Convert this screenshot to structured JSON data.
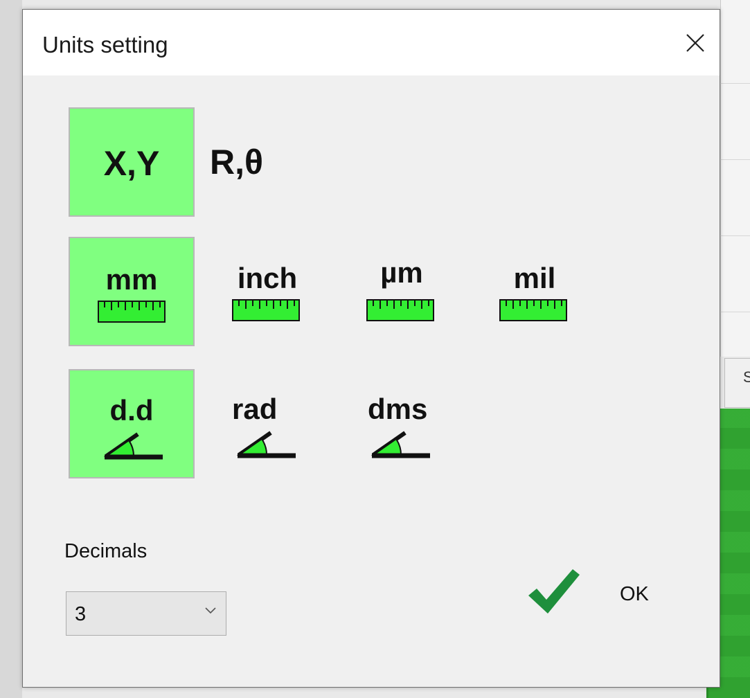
{
  "dialog": {
    "title": "Units setting",
    "close_icon": "close-icon"
  },
  "coordinates": [
    {
      "label": "X,Y",
      "selected": true
    },
    {
      "label": "R,θ",
      "selected": false
    }
  ],
  "length_units": [
    {
      "label": "mm",
      "icon": "ruler-icon",
      "selected": true
    },
    {
      "label": "inch",
      "icon": "ruler-icon",
      "selected": false
    },
    {
      "label": "µm",
      "icon": "ruler-icon",
      "selected": false
    },
    {
      "label": "mil",
      "icon": "ruler-icon",
      "selected": false
    }
  ],
  "angle_units": [
    {
      "label": "d.d",
      "icon": "angle-icon",
      "selected": true
    },
    {
      "label": "rad",
      "icon": "angle-icon",
      "selected": false
    },
    {
      "label": "dms",
      "icon": "angle-icon",
      "selected": false
    }
  ],
  "decimals": {
    "label": "Decimals",
    "value": "3"
  },
  "ok": {
    "label": "OK",
    "icon": "checkmark-icon"
  },
  "background": {
    "side_text": "S"
  },
  "colors": {
    "selected_tile": "#80ff80",
    "icon_green": "#33ee33",
    "check_green": "#1e8f3c"
  }
}
